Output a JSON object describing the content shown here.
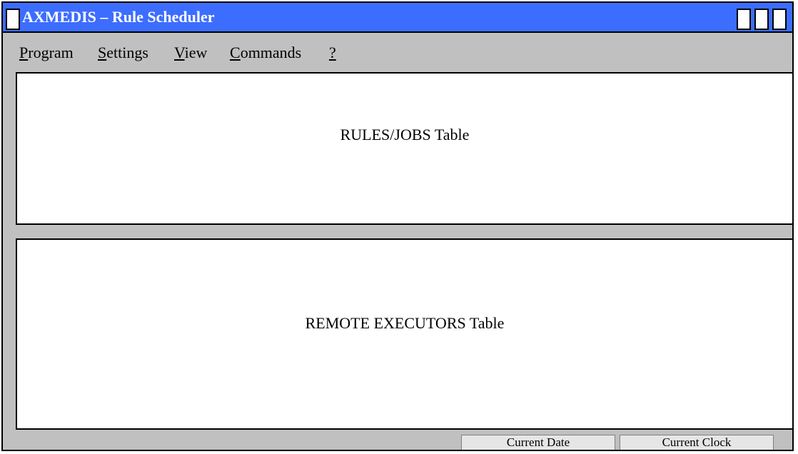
{
  "window": {
    "title": "AXMEDIS – Rule Scheduler",
    "title_bar_color": "#3c6dff",
    "background_color": "#c0c0c0"
  },
  "menu": {
    "items": [
      {
        "mnemonic": "P",
        "rest": "rogram"
      },
      {
        "mnemonic": "S",
        "rest": "ettings"
      },
      {
        "mnemonic": "V",
        "rest": "iew"
      },
      {
        "mnemonic": "C",
        "rest": "ommands"
      },
      {
        "mnemonic": "?",
        "rest": ""
      }
    ]
  },
  "panels": {
    "rules_label": "RULES/JOBS Table",
    "executors_label": "REMOTE EXECUTORS Table"
  },
  "statusbar": {
    "date_label": "Current Date",
    "clock_label": "Current Clock"
  }
}
